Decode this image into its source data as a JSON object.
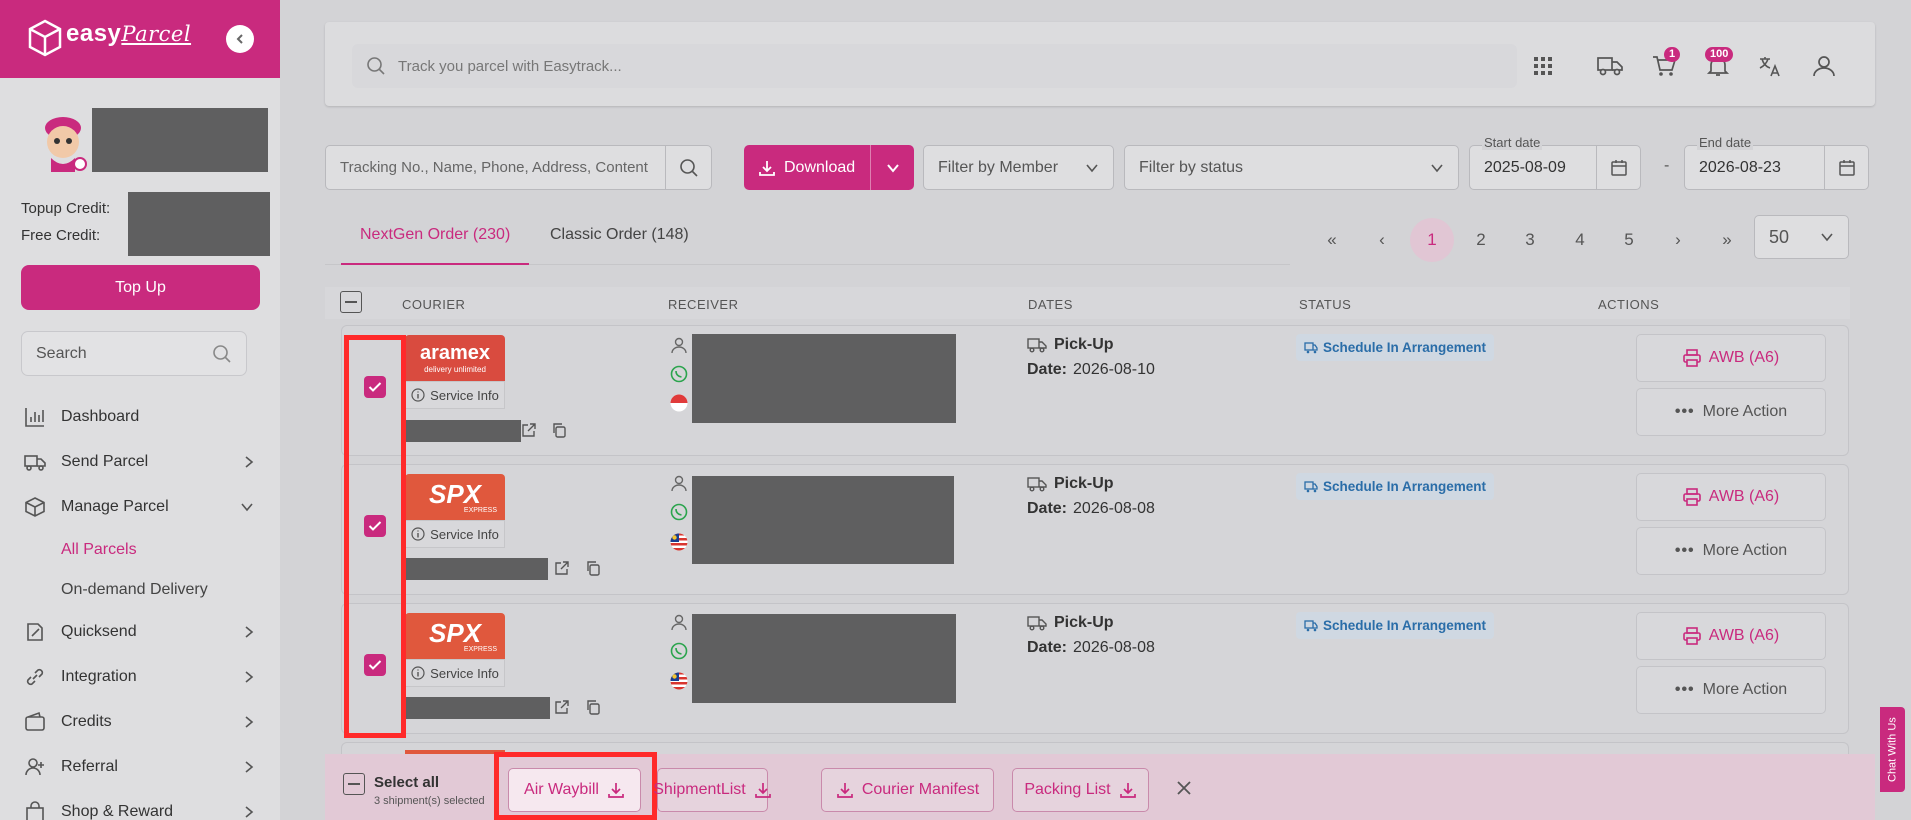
{
  "brand": {
    "name": "easy",
    "script": "Parcel",
    "accent": "#c92a7e"
  },
  "sidebar": {
    "topup_credit_label": "Topup Credit:",
    "free_credit_label": "Free Credit:",
    "topup_button": "Top Up",
    "search_placeholder": "Search",
    "items": [
      {
        "label": "Dashboard",
        "icon": "bar-chart-icon"
      },
      {
        "label": "Send Parcel",
        "icon": "truck-icon"
      },
      {
        "label": "Manage Parcel",
        "icon": "box-icon"
      },
      {
        "label": "Quicksend",
        "icon": "quicksend-icon"
      },
      {
        "label": "Integration",
        "icon": "link-icon"
      },
      {
        "label": "Credits",
        "icon": "wallet-icon"
      },
      {
        "label": "Referral",
        "icon": "user-plus-icon"
      },
      {
        "label": "Shop & Reward",
        "icon": "shopping-bag-icon"
      }
    ],
    "sub_items": [
      "All Parcels",
      "On-demand Delivery"
    ]
  },
  "header": {
    "track_placeholder": "Track you parcel with Easytrack...",
    "cart_badge": "1",
    "notification_badge": "100"
  },
  "filters": {
    "search_placeholder": "Tracking No., Name, Phone, Address, Content",
    "download_label": "Download",
    "member_placeholder": "Filter by Member",
    "status_placeholder": "Filter by status",
    "start_date_label": "Start date",
    "start_date": "2025-08-09",
    "date_separator": "-",
    "end_date_label": "End date",
    "end_date": "2026-08-23"
  },
  "tabs": [
    {
      "label": "NextGen Order (230)"
    },
    {
      "label": "Classic Order (148)"
    }
  ],
  "pagination": {
    "first": "«",
    "prev": "‹",
    "pages": [
      "1",
      "2",
      "3",
      "4",
      "5"
    ],
    "next": "›",
    "last": "»",
    "per_page": "50"
  },
  "table": {
    "headers": [
      "COURIER",
      "RECEIVER",
      "DATES",
      "STATUS",
      "ACTIONS"
    ],
    "rows": [
      {
        "courier": "aramex",
        "courier_sub": "delivery unlimited",
        "service_info": "Service Info",
        "pickup": "Pick-Up",
        "date_label": "Date:",
        "date": "2026-08-10",
        "status": "Schedule In Arrangement",
        "awb": "AWB (A6)",
        "more": "More Action"
      },
      {
        "courier": "SPX",
        "courier_sub": "EXPRESS",
        "service_info": "Service Info",
        "pickup": "Pick-Up",
        "date_label": "Date:",
        "date": "2026-08-08",
        "status": "Schedule In Arrangement",
        "awb": "AWB (A6)",
        "more": "More Action"
      },
      {
        "courier": "SPX",
        "courier_sub": "EXPRESS",
        "service_info": "Service Info",
        "pickup": "Pick-Up",
        "date_label": "Date:",
        "date": "2026-08-08",
        "status": "Schedule In Arrangement",
        "awb": "AWB (A6)",
        "more": "More Action"
      }
    ]
  },
  "bulk_bar": {
    "select_all": "Select all",
    "selected_count": "3 shipment(s) selected",
    "air_waybill": "Air Waybill",
    "shipment_list": "ShipmentList",
    "courier_manifest": "Courier Manifest",
    "packing_list": "Packing List"
  },
  "chat_tab": "Chat With Us"
}
